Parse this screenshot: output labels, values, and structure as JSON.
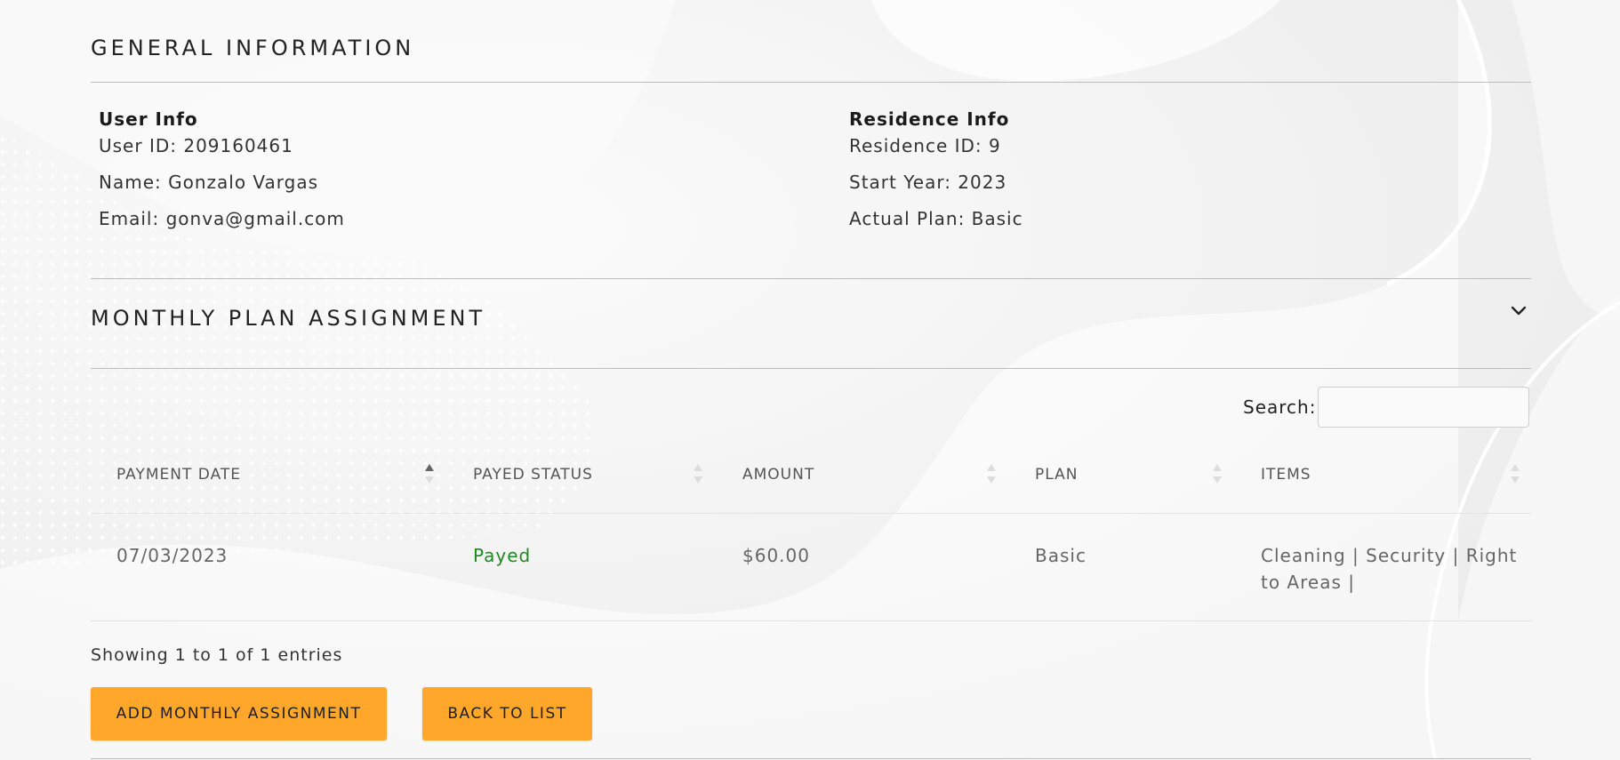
{
  "general": {
    "title": "GENERAL INFORMATION",
    "user_info": {
      "heading": "User Info",
      "user_id": "User ID: 209160461",
      "name": "Name: Gonzalo Vargas",
      "email": "Email: gonva@gmail.com"
    },
    "residence_info": {
      "heading": "Residence Info",
      "residence_id": "Residence ID: 9",
      "start_year": "Start Year: 2023",
      "actual_plan": "Actual Plan: Basic"
    }
  },
  "monthly": {
    "title": "MONTHLY PLAN ASSIGNMENT",
    "toggle_icon": "chevron-down-icon",
    "search": {
      "label": "Search:",
      "value": "",
      "placeholder": ""
    },
    "table": {
      "columns": [
        "PAYMENT DATE",
        "PAYED STATUS",
        "AMOUNT",
        "PLAN",
        "ITEMS"
      ],
      "sorted_column": "PAYMENT DATE",
      "sort_direction": "asc",
      "rows": [
        {
          "payment_date": "07/03/2023",
          "payed_status": "Payed",
          "amount": "$60.00",
          "plan": "Basic",
          "items_line1": "Cleaning | Security | Right",
          "items_line2": "to Areas |"
        }
      ]
    },
    "showing": "Showing 1 to 1 of 1 entries"
  },
  "actions": {
    "add_label": "ADD MONTHLY ASSIGNMENT",
    "back_label": "BACK TO LIST"
  },
  "colors": {
    "accent": "#ffa72a",
    "status_ok": "#1f8a1f",
    "background": "#f4f4f4"
  }
}
